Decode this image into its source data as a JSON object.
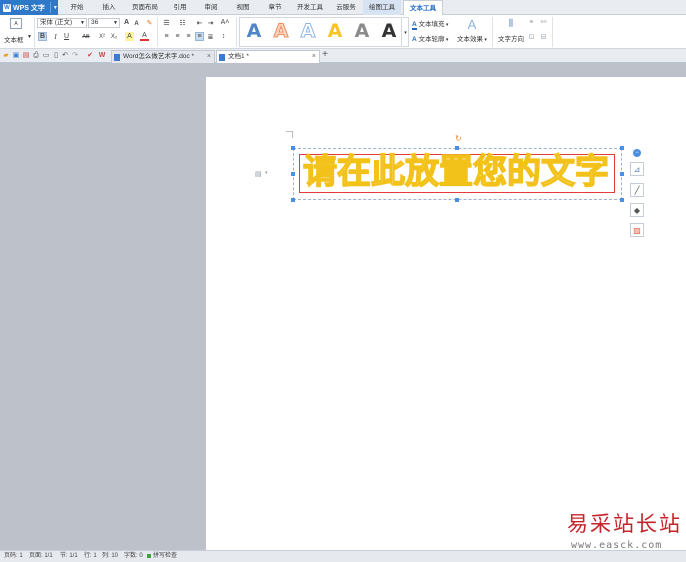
{
  "app": {
    "name": "WPS 文字"
  },
  "menu": {
    "tabs": [
      "开始",
      "插入",
      "页面布局",
      "引用",
      "审阅",
      "视图",
      "章节",
      "开发工具",
      "云服务",
      "绘图工具",
      "文本工具"
    ],
    "active_tab": "文本工具",
    "context_tab": "绘图工具"
  },
  "ribbon": {
    "textbox_label": "文本框",
    "font_name": "宋体 (正文)",
    "font_size": "36",
    "font_grow": "A",
    "font_shrink": "A",
    "bold": "B",
    "italic": "I",
    "underline": "U",
    "strike": "AB",
    "superscript": "X²",
    "subscript": "X₂",
    "font_color": "A",
    "highlight": "A",
    "styles": [
      "A",
      "A",
      "A",
      "A",
      "A",
      "A"
    ],
    "style_colors": [
      "#111111",
      "#4f86c6",
      "#f08c5a",
      "#ffffff",
      "#f6c52a",
      "#8a8a8a"
    ],
    "text_fill_label": "文本填充",
    "text_outline_label": "文本轮廓",
    "text_effect_label": "文本效果",
    "text_direction_label": "文字方向"
  },
  "doc_tabs": [
    {
      "title": "Word怎么做艺术字.doc *",
      "active": false
    },
    {
      "title": "文档1 *",
      "active": true
    }
  ],
  "document": {
    "wordart_text": "请在此放置您的文字"
  },
  "status": {
    "page": "页码: 1",
    "pages": "页面: 1/1",
    "section": "节: 1/1",
    "row": "行: 1",
    "col": "列: 10",
    "words": "字数: 0",
    "spell": "拼写检查"
  },
  "watermark": {
    "cn": "易采站长站",
    "url": "www.easck.com"
  },
  "colors": {
    "accent": "#2f78c8",
    "wordart_stroke": "#f3c21a",
    "textbox_border": "#e53b3b"
  }
}
